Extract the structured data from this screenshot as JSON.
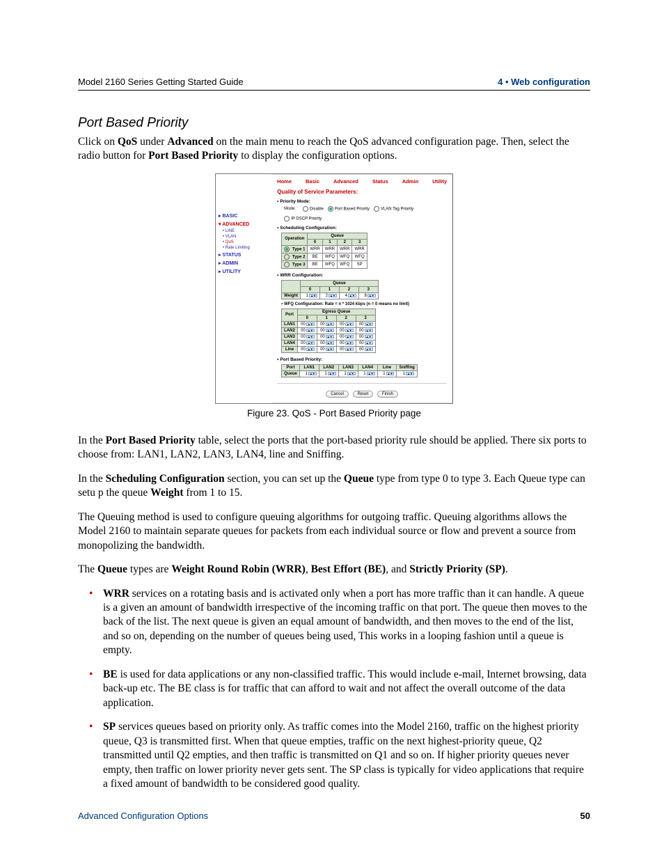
{
  "header": {
    "left": "Model 2160 Series Getting Started Guide",
    "right": "4 • Web configuration"
  },
  "footer": {
    "left": "Advanced Configuration Options",
    "page": "50"
  },
  "title": "Port Based Priority",
  "intro": {
    "p1_a": "Click on ",
    "p1_b": "QoS",
    "p1_c": " under ",
    "p1_d": "Advanced",
    "p1_e": " on the main menu to reach the QoS advanced configuration page. Then, select the radio button for ",
    "p1_f": "Port Based Priority",
    "p1_g": " to display the configuration options."
  },
  "figure_caption": "Figure 23. QoS - Port Based Priority page",
  "body": {
    "p2_a": "In the ",
    "p2_b": "Port Based Priority",
    "p2_c": " table, select the ports that the port-based priority rule should be applied. There six ports to choose from: LAN1, LAN2, LAN3, LAN4, line and Sniffing.",
    "p3_a": "In the ",
    "p3_b": "Scheduling Configuration",
    "p3_c": " section, you can set up the ",
    "p3_d": "Queue",
    "p3_e": " type from type 0 to type 3. Each Queue type can setu p the queue ",
    "p3_f": "Weight",
    "p3_g": " from 1 to 15.",
    "p4": "The Queuing method is used to configure queuing algorithms for outgoing traffic. Queuing algorithms allows the Model 2160 to maintain separate queues for packets from each individual source or flow and prevent a source from monopolizing the bandwidth.",
    "p5_a": "The ",
    "p5_b": "Queue",
    "p5_c": " types are ",
    "p5_d": "Weight Round Robin (WRR)",
    "p5_e": ", ",
    "p5_f": "Best Effort (BE)",
    "p5_g": ", and ",
    "p5_h": "Strictly Priority (SP)",
    "p5_i": "."
  },
  "bullets": {
    "b1_a": "WRR",
    "b1_b": " services on a rotating basis and is activated only when a port has more traffic than it can handle. A queue is a given an amount of bandwidth irrespective of the incoming traffic on that port. The queue then moves to the back of the list. The next queue is given an equal amount of bandwidth, and then moves to the end of the list, and so on, depending on the number of queues being used, This works in a looping fashion until a queue is empty.",
    "b2_a": "BE",
    "b2_b": " is used for data applications or any non-classified traffic. This would include e-mail, Internet browsing, data back-up etc. The BE class is for traffic that can afford to wait and not affect the overall outcome of the data application.",
    "b3_a": "SP",
    "b3_b": " services queues based on priority only. As traffic comes into the Model 2160, traffic on the highest priority queue, Q3 is transmitted first. When that queue empties, traffic on the next highest-priority queue, Q2 transmitted until Q2 empties, and then traffic is transmitted on Q1 and so on. If higher priority queues never empty, then traffic on lower priority never gets sent. The SP class is typically for video applications that require a fixed amount of bandwidth to be considered good quality."
  },
  "shot": {
    "nav": [
      "Home",
      "Basic",
      "Advanced",
      "Status",
      "Admin",
      "Utility"
    ],
    "sidebar": {
      "basic": "BASIC",
      "advanced": "ADVANCED",
      "adv_items": [
        "LINE",
        "VLAN",
        "QoS",
        "Rate Limiting"
      ],
      "status": "STATUS",
      "admin": "ADMIN",
      "utility": "UTILITY"
    },
    "panel_title": "Quality of Service Parameters:",
    "priority_mode_label": "Priority Mode:",
    "mode_label": "Mode:",
    "modes": [
      "Disable",
      "Port Based Priority",
      "VLAN Tag Priority",
      "IP DSCP Priority"
    ],
    "sched_label": "Scheduling Configuration:",
    "sched_table": {
      "col_head": "Operation",
      "queue_head": "Queue",
      "cols": [
        "0",
        "1",
        "2",
        "3"
      ],
      "rows": [
        {
          "name": "Type 1",
          "cells": [
            "WRR",
            "WRR",
            "WRR",
            "WRR"
          ],
          "sel": true
        },
        {
          "name": "Type 2",
          "cells": [
            "BE",
            "WFQ",
            "WFQ",
            "WFQ"
          ],
          "sel": false
        },
        {
          "name": "Type 3",
          "cells": [
            "BE",
            "WFQ",
            "WFQ",
            "SP"
          ],
          "sel": false
        }
      ]
    },
    "wrr_label": "WRR Configuration:",
    "wrr_table": {
      "queue_head": "Queue",
      "cols": [
        "0",
        "1",
        "2",
        "3"
      ],
      "row_label": "Weight",
      "values": [
        "1",
        "2",
        "4",
        "8"
      ]
    },
    "wfq_note": "WFQ Configuration: Rate = n * 1024 kbps (n = 0 means no limit)",
    "wfq_table": {
      "port_head": "Port",
      "eg_head": "Egress Queue",
      "cols": [
        "0",
        "1",
        "2",
        "3"
      ],
      "rows": [
        "LAN1",
        "LAN2",
        "LAN3",
        "LAN4",
        "Line"
      ],
      "val": "00"
    },
    "pbp_label": "Port Based Priority:",
    "pbp_table": {
      "row_label": "Port",
      "q_label": "Queue",
      "cols": [
        "LAN1",
        "LAN2",
        "LAN3",
        "LAN4",
        "Line",
        "Sniffing"
      ],
      "val": "1"
    },
    "buttons": [
      "Cancel",
      "Reset",
      "Finish"
    ]
  }
}
